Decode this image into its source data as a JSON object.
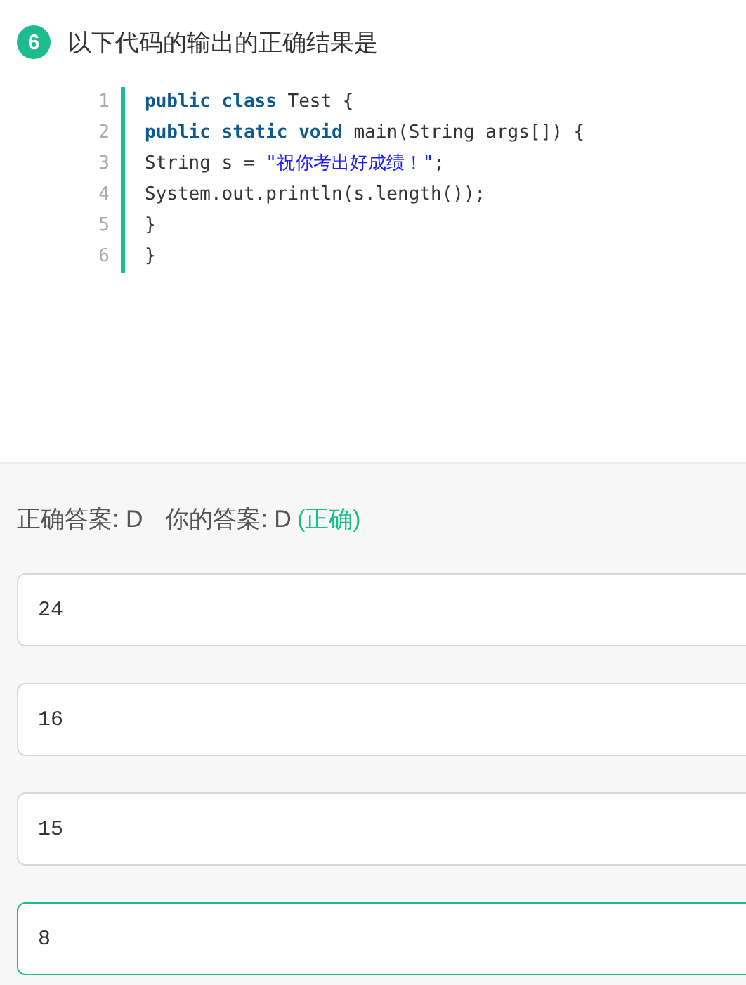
{
  "question": {
    "number": "6",
    "text": "以下代码的输出的正确结果是"
  },
  "code": [
    {
      "number": "1",
      "tokens": [
        {
          "kind": "keyword",
          "text": "public class"
        },
        {
          "kind": "plain",
          "text": " Test {"
        }
      ]
    },
    {
      "number": "2",
      "tokens": [
        {
          "kind": "keyword",
          "text": "public static void"
        },
        {
          "kind": "plain",
          "text": " main(String args[]) {"
        }
      ]
    },
    {
      "number": "3",
      "tokens": [
        {
          "kind": "plain",
          "text": "String s = "
        },
        {
          "kind": "string",
          "text": "\"祝你考出好成绩！\""
        },
        {
          "kind": "plain",
          "text": ";"
        }
      ]
    },
    {
      "number": "4",
      "tokens": [
        {
          "kind": "plain",
          "text": "System.out.println(s.length());"
        }
      ]
    },
    {
      "number": "5",
      "tokens": [
        {
          "kind": "plain",
          "text": "}"
        }
      ]
    },
    {
      "number": "6",
      "tokens": [
        {
          "kind": "plain",
          "text": "}"
        }
      ]
    }
  ],
  "result": {
    "correct_answer": "正确答案: D",
    "your_answer": "你的答案: D",
    "verdict": "(正确)"
  },
  "options": [
    {
      "text": "24",
      "selected": false
    },
    {
      "text": "16",
      "selected": false
    },
    {
      "text": "15",
      "selected": false
    },
    {
      "text": "8",
      "selected": true
    }
  ]
}
